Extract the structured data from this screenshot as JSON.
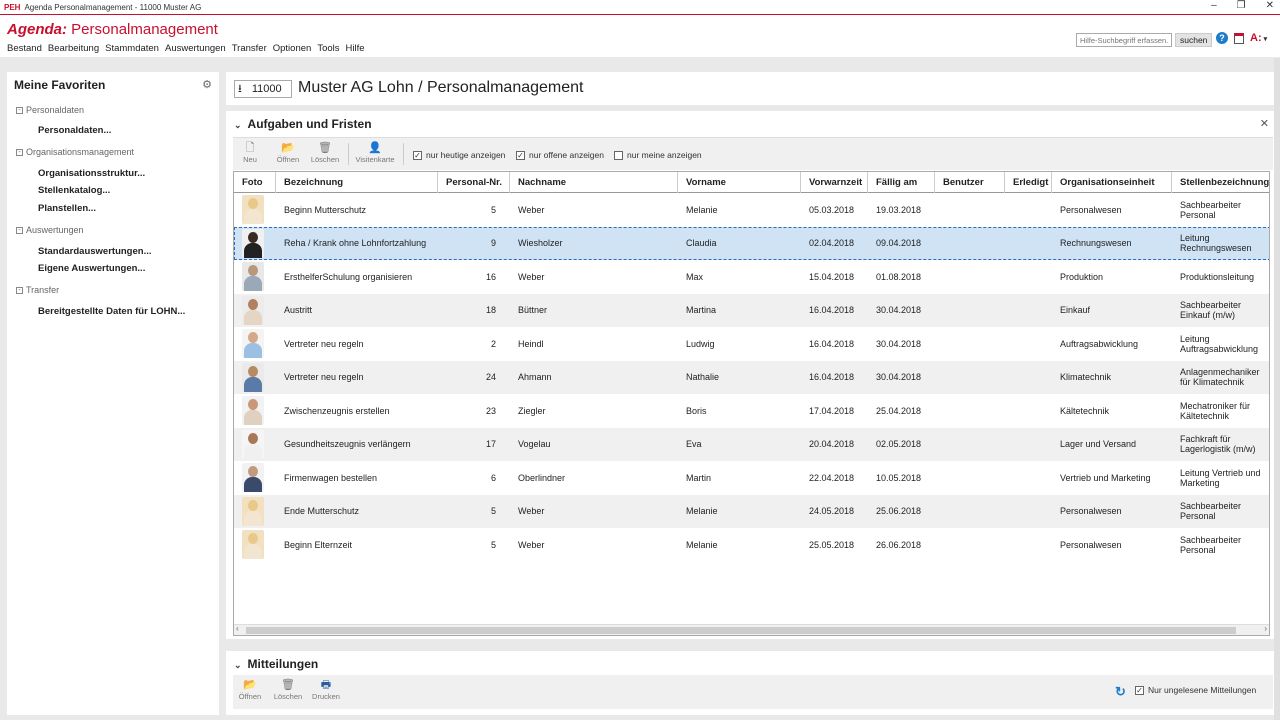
{
  "window": {
    "logo": "PEH",
    "title": "Agenda  Personalmanagement - 11000 Muster AG",
    "controls": [
      "–",
      "❐",
      "✕"
    ]
  },
  "app": {
    "brand_name": "Agenda:",
    "brand_module": "Personalmanagement",
    "brand_color": "#c8102e",
    "menu": [
      "Bestand",
      "Bearbeitung",
      "Stammdaten",
      "Auswertungen",
      "Transfer",
      "Optionen",
      "Tools",
      "Hilfe"
    ],
    "help_search_placeholder": "Hilfe-Suchbegriff erfassen...",
    "help_search_button": "suchen",
    "help_icon": "?",
    "user_menu": "A:",
    "user_menu_caret": "▾"
  },
  "sidebar": {
    "title": "Meine Favoriten",
    "groups": [
      {
        "label": "Personaldaten",
        "items": [
          "Personaldaten..."
        ]
      },
      {
        "label": "Organisationsmanagement",
        "items": [
          "Organisationsstruktur...",
          "Stellenkatalog...",
          "Planstellen..."
        ]
      },
      {
        "label": "Auswertungen",
        "items": [
          "Standardauswertungen...",
          "Eigene Auswertungen..."
        ]
      },
      {
        "label": "Transfer",
        "items": [
          "Bereitgestellte Daten für LOHN..."
        ]
      }
    ]
  },
  "page": {
    "client_number": "11000",
    "title": "Muster AG Lohn / Personalmanagement"
  },
  "tasks": {
    "title": "Aufgaben und Fristen",
    "toolbar": {
      "new": "Neu",
      "open": "Öffnen",
      "delete": "Löschen",
      "vcard": "Visitenkarte"
    },
    "filters": [
      {
        "label": "nur heutige anzeigen",
        "checked": true
      },
      {
        "label": "nur offene anzeigen",
        "checked": true
      },
      {
        "label": "nur meine anzeigen",
        "checked": false
      }
    ],
    "columns": [
      "Foto",
      "Bezeichnung",
      "Personal-Nr.",
      "Nachname",
      "Vorname",
      "Vorwarnzeit",
      "Fällig am",
      "Benutzer",
      "Erledigt",
      "Organisationseinheit",
      "Stellenbezeichnung"
    ],
    "rows": [
      {
        "photo": "female-blonde",
        "bezeichnung": "Beginn Mutterschutz",
        "nr": "5",
        "nachname": "Weber",
        "vorname": "Melanie",
        "vorwarn": "05.03.2018",
        "faellig": "19.03.2018",
        "benutzer": "",
        "erledigt": "",
        "org": "Personalwesen",
        "stelle": "Sachbearbeiter Personal"
      },
      {
        "photo": "female-dark",
        "bezeichnung": "Reha / Krank ohne Lohnfortzahlung",
        "nr": "9",
        "nachname": "Wiesholzer",
        "vorname": "Claudia",
        "vorwarn": "02.04.2018",
        "faellig": "09.04.2018",
        "benutzer": "",
        "erledigt": "",
        "org": "Rechnungswesen",
        "stelle": "Leitung Rechnungswesen"
      },
      {
        "photo": "male-grey",
        "bezeichnung": "ErsthelferSchulung organisieren",
        "nr": "16",
        "nachname": "Weber",
        "vorname": "Max",
        "vorwarn": "15.04.2018",
        "faellig": "01.08.2018",
        "benutzer": "",
        "erledigt": "",
        "org": "Produktion",
        "stelle": "Produktionsleitung"
      },
      {
        "photo": "female-brown",
        "bezeichnung": "Austritt",
        "nr": "18",
        "nachname": "Büttner",
        "vorname": "Martina",
        "vorwarn": "16.04.2018",
        "faellig": "30.04.2018",
        "benutzer": "",
        "erledigt": "",
        "org": "Einkauf",
        "stelle": "Sachbearbeiter Einkauf (m/w)"
      },
      {
        "photo": "male-shirt",
        "bezeichnung": "Vertreter neu regeln",
        "nr": "2",
        "nachname": "Heindl",
        "vorname": "Ludwig",
        "vorwarn": "16.04.2018",
        "faellig": "30.04.2018",
        "benutzer": "",
        "erledigt": "",
        "org": "Auftragsabwicklung",
        "stelle": "Leitung Auftragsabwicklung"
      },
      {
        "photo": "female-blue",
        "bezeichnung": "Vertreter neu regeln",
        "nr": "24",
        "nachname": "Ahmann",
        "vorname": "Nathalie",
        "vorwarn": "16.04.2018",
        "faellig": "30.04.2018",
        "benutzer": "",
        "erledigt": "",
        "org": "Klimatechnik",
        "stelle": "Anlagenmechaniker für Klimatechnik"
      },
      {
        "photo": "male-casual",
        "bezeichnung": "Zwischenzeugnis erstellen",
        "nr": "23",
        "nachname": "Ziegler",
        "vorname": "Boris",
        "vorwarn": "17.04.2018",
        "faellig": "25.04.2018",
        "benutzer": "",
        "erledigt": "",
        "org": "Kältetechnik",
        "stelle": "Mechatroniker für Kältetechnik"
      },
      {
        "photo": "female-light",
        "bezeichnung": "Gesundheitszeugnis verlängern",
        "nr": "17",
        "nachname": "Vogelau",
        "vorname": "Eva",
        "vorwarn": "20.04.2018",
        "faellig": "02.05.2018",
        "benutzer": "",
        "erledigt": "",
        "org": "Lager und Versand",
        "stelle": "Fachkraft für Lagerlogistik (m/w)"
      },
      {
        "photo": "male-suit",
        "bezeichnung": "Firmenwagen bestellen",
        "nr": "6",
        "nachname": "Oberlindner",
        "vorname": "Martin",
        "vorwarn": "22.04.2018",
        "faellig": "10.05.2018",
        "benutzer": "",
        "erledigt": "",
        "org": "Vertrieb und Marketing",
        "stelle": "Leitung Vertrieb und Marketing"
      },
      {
        "photo": "female-blonde",
        "bezeichnung": "Ende Mutterschutz",
        "nr": "5",
        "nachname": "Weber",
        "vorname": "Melanie",
        "vorwarn": "24.05.2018",
        "faellig": "25.06.2018",
        "benutzer": "",
        "erledigt": "",
        "org": "Personalwesen",
        "stelle": "Sachbearbeiter Personal"
      },
      {
        "photo": "female-blonde",
        "bezeichnung": "Beginn Elternzeit",
        "nr": "5",
        "nachname": "Weber",
        "vorname": "Melanie",
        "vorwarn": "25.05.2018",
        "faellig": "26.06.2018",
        "benutzer": "",
        "erledigt": "",
        "org": "Personalwesen",
        "stelle": "Sachbearbeiter Personal"
      }
    ],
    "selected_row": 1
  },
  "messages": {
    "title": "Mitteilungen",
    "toolbar": {
      "open": "Öffnen",
      "delete": "Löschen",
      "print": "Drucken"
    },
    "unread_filter": {
      "label": "Nur ungelesene Mitteilungen",
      "checked": true
    }
  }
}
